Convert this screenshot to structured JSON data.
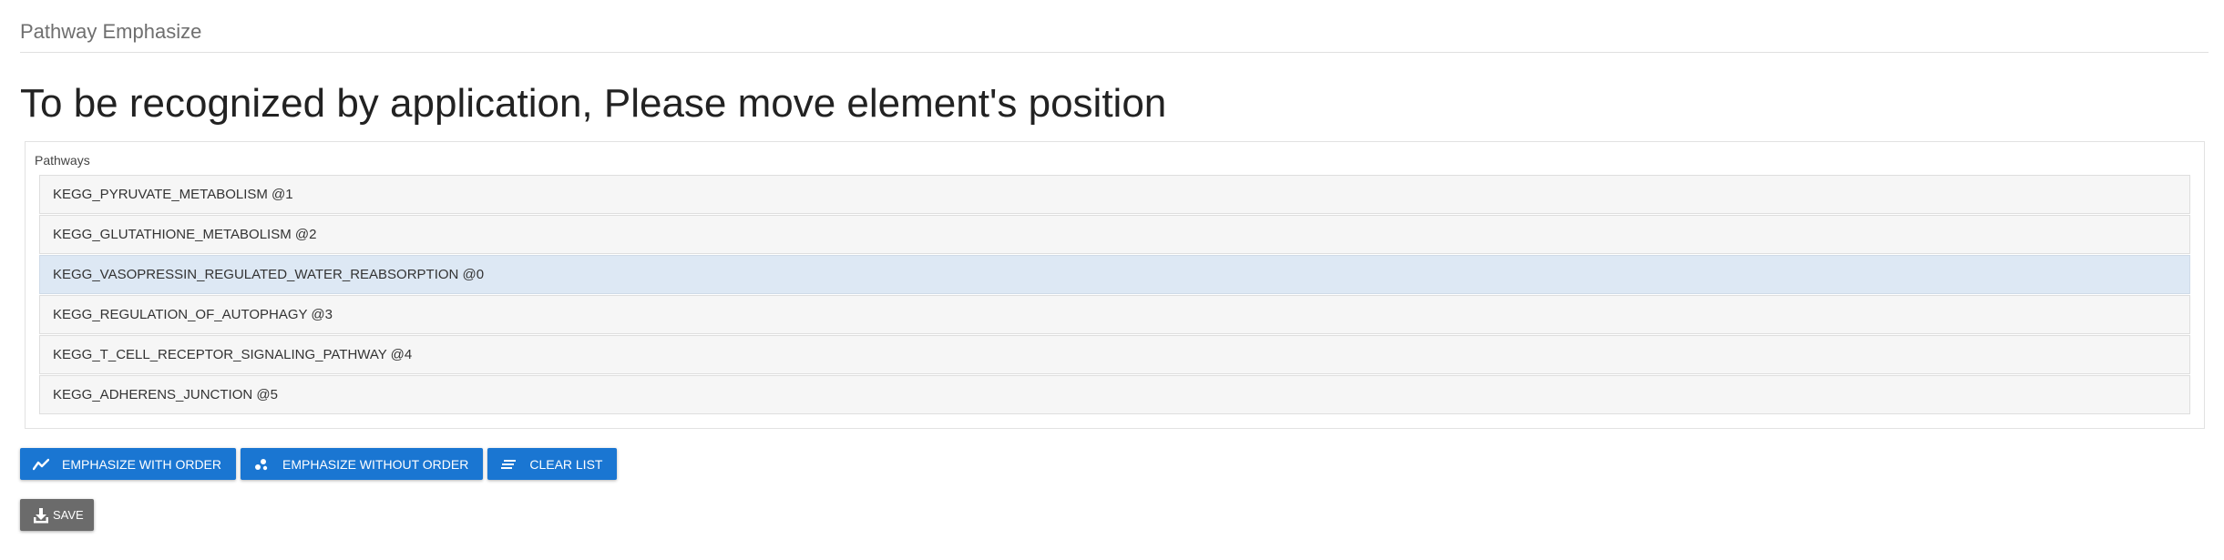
{
  "section": {
    "title": "Pathway Emphasize"
  },
  "main": {
    "heading": "To be recognized by application, Please move element's position"
  },
  "pathways": {
    "label": "Pathways",
    "items": [
      {
        "label": "KEGG_PYRUVATE_METABOLISM @1",
        "selected": false
      },
      {
        "label": "KEGG_GLUTATHIONE_METABOLISM @2",
        "selected": false
      },
      {
        "label": "KEGG_VASOPRESSIN_REGULATED_WATER_REABSORPTION @0",
        "selected": true
      },
      {
        "label": "KEGG_REGULATION_OF_AUTOPHAGY @3",
        "selected": false
      },
      {
        "label": "KEGG_T_CELL_RECEPTOR_SIGNALING_PATHWAY @4",
        "selected": false
      },
      {
        "label": "KEGG_ADHERENS_JUNCTION @5",
        "selected": false
      }
    ]
  },
  "actions": {
    "emphasize_with_order": {
      "label": "EMPHASIZE WITH ORDER",
      "icon": "trending-line-icon"
    },
    "emphasize_without_order": {
      "label": "EMPHASIZE WITHOUT ORDER",
      "icon": "scatter-dots-icon"
    },
    "clear_list": {
      "label": "CLEAR LIST",
      "icon": "clear-lines-icon"
    },
    "save": {
      "label": "SAVE",
      "icon": "download-icon"
    }
  },
  "colors": {
    "primary_button": "#1a76d2",
    "save_button": "#6b6b6b",
    "selected_row": "#dde8f4",
    "row_background": "#f6f6f6"
  }
}
